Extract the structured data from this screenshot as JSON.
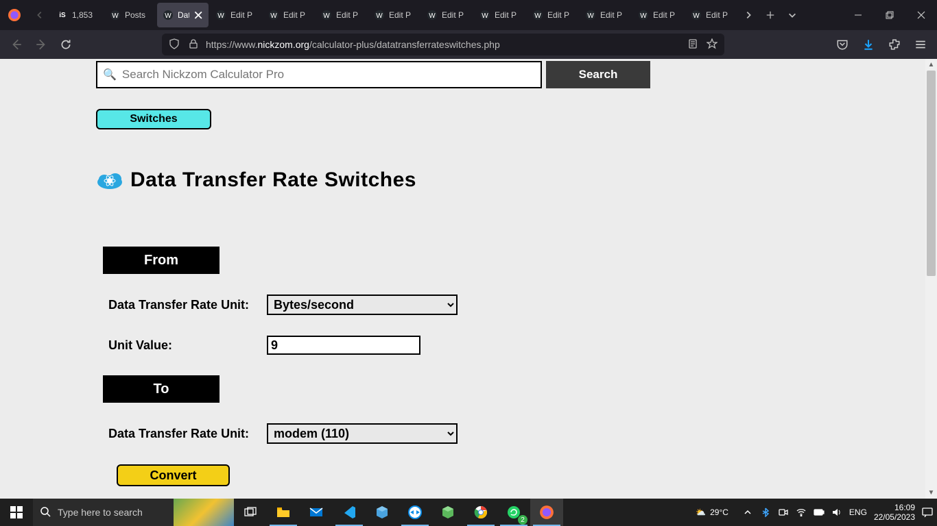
{
  "browser": {
    "tabs": [
      {
        "title": "1,853",
        "fav": "is"
      },
      {
        "title": "Posts",
        "fav": "wp"
      },
      {
        "title": "Dat",
        "fav": "wp",
        "active": true
      },
      {
        "title": "Edit P",
        "fav": "wp"
      },
      {
        "title": "Edit P",
        "fav": "wp"
      },
      {
        "title": "Edit P",
        "fav": "wp"
      },
      {
        "title": "Edit P",
        "fav": "wp"
      },
      {
        "title": "Edit P",
        "fav": "wp"
      },
      {
        "title": "Edit P",
        "fav": "wp"
      },
      {
        "title": "Edit P",
        "fav": "wp"
      },
      {
        "title": "Edit P",
        "fav": "wp"
      },
      {
        "title": "Edit P",
        "fav": "wp"
      },
      {
        "title": "Edit P",
        "fav": "wp"
      }
    ],
    "url_prefix": "https://www.",
    "url_host": "nickzom.org",
    "url_path": "/calculator-plus/datatransferrateswitches.php"
  },
  "page": {
    "search_placeholder": "Search Nickzom Calculator Pro",
    "search_btn": "Search",
    "switches_btn": "Switches",
    "title": "Data Transfer Rate Switches",
    "from_label": "From",
    "to_label": "To",
    "unit_label": "Data Transfer Rate Unit:",
    "value_label": "Unit Value:",
    "from_unit": "Bytes/second",
    "value": "9",
    "to_unit": "modem (110)",
    "convert_btn": "Convert"
  },
  "taskbar": {
    "search_placeholder": "Type here to search",
    "weather": "29°C",
    "lang": "ENG",
    "time": "16:09",
    "date": "22/05/2023",
    "whatsapp_badge": "2"
  }
}
